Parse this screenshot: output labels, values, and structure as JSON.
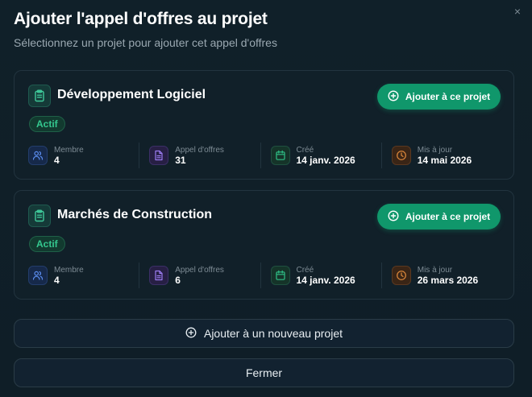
{
  "dialog": {
    "title": "Ajouter l'appel d'offres au projet",
    "subtitle": "Sélectionnez un projet pour ajouter cet appel d'offres",
    "close_icon": "×"
  },
  "projects": [
    {
      "name": "Développement Logiciel",
      "status": "Actif",
      "add_label": "Ajouter à ce projet",
      "stats": [
        {
          "label": "Membre",
          "value": "4",
          "icon": "users-icon",
          "color": "#5b8def"
        },
        {
          "label": "Appel d'offres",
          "value": "31",
          "icon": "document-icon",
          "color": "#9b7cf0"
        },
        {
          "label": "Créé",
          "value": "14 janv. 2026",
          "icon": "calendar-icon",
          "color": "#2fbf86"
        },
        {
          "label": "Mis à jour",
          "value": "14 mai 2026",
          "icon": "clock-icon",
          "color": "#e08a3c"
        }
      ]
    },
    {
      "name": "Marchés de Construction",
      "status": "Actif",
      "add_label": "Ajouter à ce projet",
      "stats": [
        {
          "label": "Membre",
          "value": "4",
          "icon": "users-icon",
          "color": "#5b8def"
        },
        {
          "label": "Appel d'offres",
          "value": "6",
          "icon": "document-icon",
          "color": "#9b7cf0"
        },
        {
          "label": "Créé",
          "value": "14 janv. 2026",
          "icon": "calendar-icon",
          "color": "#2fbf86"
        },
        {
          "label": "Mis à jour",
          "value": "26 mars 2026",
          "icon": "clock-icon",
          "color": "#e08a3c"
        }
      ]
    }
  ],
  "actions": {
    "new_project_label": "Ajouter à un nouveau projet",
    "close_label": "Fermer"
  },
  "colors": {
    "accent": "#10976b",
    "badge_text": "#34c88f"
  }
}
